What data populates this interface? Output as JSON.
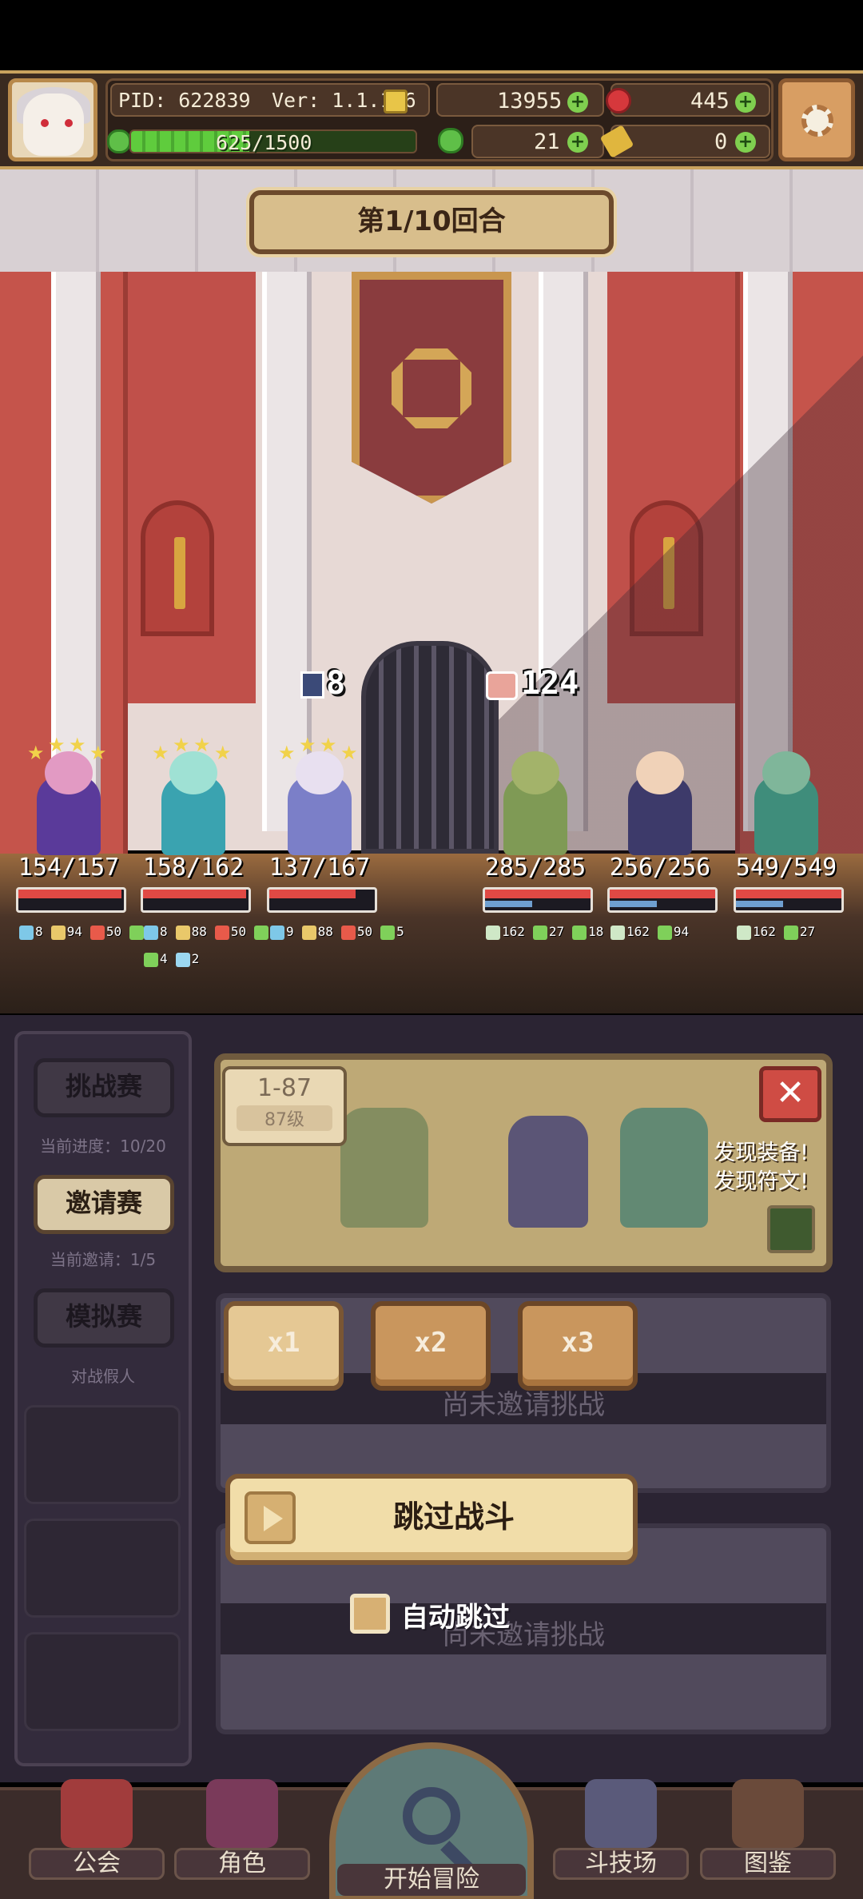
{
  "header": {
    "pid": "PID: 622839",
    "version": "Ver: 1.1.1.6",
    "gold": "13955",
    "gems": "445",
    "exp_text": "625/1500",
    "exp_progress": 0.4167,
    "clover": "21",
    "hammer": "0",
    "icons": {
      "gold": "gold-coin-icon",
      "gem": "red-gem-icon",
      "clover": "clover-icon",
      "hammer": "hammer-icon",
      "plus": "plus-icon",
      "settings": "gear-icon"
    }
  },
  "battle": {
    "round_title": "第1/10回合",
    "damage_left": "8",
    "damage_right": "124",
    "allies": [
      {
        "hp": "154/157",
        "hp_frac": 0.98,
        "buffs": [
          [
            "8",
            "shield"
          ],
          [
            "94",
            "scroll"
          ],
          [
            "50",
            "cap"
          ],
          [
            "4",
            "arrow"
          ]
        ],
        "buffs2": [],
        "colors": {
          "body": "#5a3a9a",
          "head": "#e29ac3"
        }
      },
      {
        "hp": "158/162",
        "hp_frac": 0.975,
        "buffs": [
          [
            "8",
            "shield"
          ],
          [
            "88",
            "scroll"
          ],
          [
            "50",
            "cap"
          ],
          [
            "4",
            "arrow"
          ]
        ],
        "buffs2": [
          [
            "4",
            "arrow"
          ],
          [
            "2",
            "drop"
          ]
        ],
        "colors": {
          "body": "#3aa3b0",
          "head": "#9fe1d4"
        }
      },
      {
        "hp": "137/167",
        "hp_frac": 0.82,
        "buffs": [
          [
            "9",
            "shield"
          ],
          [
            "88",
            "scroll"
          ],
          [
            "50",
            "cap"
          ],
          [
            "5",
            "arrow"
          ]
        ],
        "buffs2": [],
        "colors": {
          "body": "#7b7fc8",
          "head": "#e8e0f0"
        }
      }
    ],
    "enemies": [
      {
        "hp": "285/285",
        "hp_frac": 1.0,
        "buffs": [
          [
            "162",
            "skull"
          ],
          [
            "27",
            "arrow"
          ],
          [
            "18",
            "arrow"
          ]
        ],
        "colors": {
          "body": "#7f9a55",
          "head": "#a3b36a"
        }
      },
      {
        "hp": "256/256",
        "hp_frac": 1.0,
        "buffs": [
          [
            "162",
            "skull"
          ],
          [
            "94",
            "arrow"
          ]
        ],
        "colors": {
          "body": "#3d3a6a",
          "head": "#f0d2b8"
        }
      },
      {
        "hp": "549/549",
        "hp_frac": 1.0,
        "buffs": [
          [
            "162",
            "skull"
          ],
          [
            "27",
            "arrow"
          ]
        ],
        "colors": {
          "body": "#3f8d7b",
          "head": "#7fb69a"
        }
      }
    ]
  },
  "left_menu": {
    "challenge": {
      "label": "挑战赛",
      "sub": "当前进度：10/20"
    },
    "invite": {
      "label": "邀请赛",
      "sub": "当前邀请：1/5"
    },
    "sim": {
      "label": "模拟赛",
      "sub": "对战假人"
    }
  },
  "stage_card": {
    "stage": "1-87",
    "level": "87级",
    "close": "✕",
    "found1": "发现装备!",
    "found2": "发现符文!"
  },
  "speed_buttons": [
    "x1",
    "x2",
    "x3"
  ],
  "ghost_text": "尚未邀请挑战",
  "skip_label": "跳过战斗",
  "auto_skip_label": "自动跳过",
  "auto_skip_checked": false,
  "nav": {
    "guild": "公会",
    "character": "角色",
    "adventure": "开始冒险",
    "arena": "斗技场",
    "codex": "图鉴"
  },
  "colors": {
    "ui_brown": "#6b4c33",
    "cream": "#f1dda9",
    "hp_red": "#e04944",
    "mana_blue": "#6f9fd0",
    "exp_green": "#5fcc3d"
  }
}
